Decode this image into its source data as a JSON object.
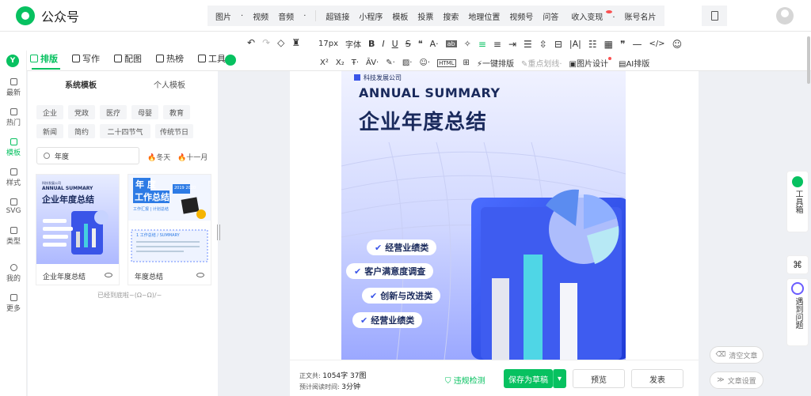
{
  "header": {
    "app_name": "公众号",
    "insert_items": [
      "图片",
      "视频",
      "音频",
      "超链接",
      "小程序",
      "模板",
      "投票",
      "搜索",
      "地理位置",
      "视频号",
      "问答",
      "收入变现",
      "账号名片"
    ]
  },
  "toolbar": {
    "font_size": "17px",
    "font_label": "字体",
    "one_key": "一键排版",
    "focus_line": "重点划线",
    "picture_design": "图片设计",
    "ai_layout": "AI排版"
  },
  "leftnav": {
    "items": [
      "最新",
      "热门",
      "模板",
      "样式",
      "SVG",
      "类型",
      "我的",
      "更多"
    ]
  },
  "toptabs": {
    "items": [
      "排版",
      "写作",
      "配图",
      "热榜",
      "工具"
    ]
  },
  "panel": {
    "subtabs": [
      "系统模板",
      "个人模板"
    ],
    "chips": [
      "企业",
      "党政",
      "医疗",
      "母婴",
      "教育",
      "新闻",
      "简约",
      "二十四节气",
      "传统节日"
    ],
    "search_value": "年度",
    "hot_tags": [
      "冬天",
      "十一月"
    ],
    "cards": [
      {
        "name": "企业年度总结"
      },
      {
        "name": "年度总结"
      }
    ],
    "end_text": "已经到底啦~(Ω~Ω)/~"
  },
  "poster": {
    "company": "科技发展公司",
    "eyebrow": "ANNUAL SUMMARY",
    "title": "企业年度总结",
    "items": [
      "经营业绩类",
      "客户满意度调查",
      "创新与改进类",
      "经营业绩类"
    ]
  },
  "thumb2": {
    "title_a": "年 度",
    "title_b": "工作总结",
    "years": "2019 2020",
    "small": "工作汇报 | 计划总结",
    "section": "1 工作总结 / SUMMARY"
  },
  "footer": {
    "word_count_label": "正文共:",
    "word_count": "1054字 37图",
    "read_time_label": "预计阅读时间:",
    "read_time": "3分钟",
    "violation_check": "违规检测",
    "save_draft": "保存为草稿",
    "preview": "预览",
    "publish": "发表"
  },
  "side": {
    "clear": "清空文章",
    "settings": "文章设置",
    "toolbox": "工具箱",
    "problem": "遇到问题"
  },
  "colors": {
    "accent": "#07c160",
    "poster_title": "#1a2a5c"
  }
}
